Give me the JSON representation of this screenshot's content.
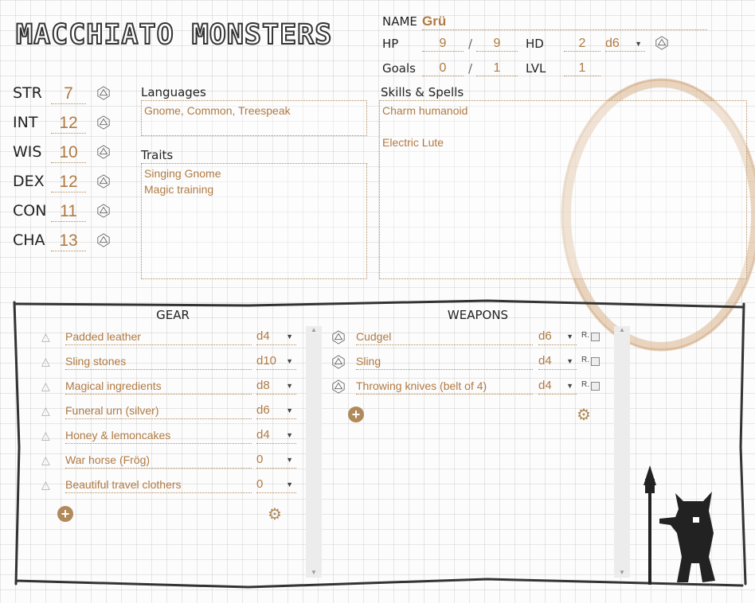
{
  "app": {
    "title": "MACCHIATO MONSTERS"
  },
  "header": {
    "name_label": "NAME",
    "name": "Grü",
    "hp_label": "HP",
    "hp": "9",
    "hp_sep": "/",
    "hp_max": "9",
    "hd_label": "HD",
    "hd": "2",
    "hd_die": "d6",
    "goals_label": "Goals",
    "goals": "0",
    "goals_sep": "/",
    "goals_max": "1",
    "lvl_label": "LVL",
    "lvl": "1"
  },
  "stats": [
    {
      "name": "STR",
      "value": "7"
    },
    {
      "name": "INT",
      "value": "12"
    },
    {
      "name": "WIS",
      "value": "10"
    },
    {
      "name": "DEX",
      "value": "12"
    },
    {
      "name": "CON",
      "value": "11"
    },
    {
      "name": "CHA",
      "value": "13"
    }
  ],
  "languages": {
    "label": "Languages",
    "text": "Gnome, Common, Treespeak"
  },
  "traits": {
    "label": "Traits",
    "lines": [
      "Singing Gnome",
      "Magic training"
    ]
  },
  "skills": {
    "label": "Skills & Spells",
    "lines": [
      "Charm humanoid",
      "",
      "Electric Lute"
    ]
  },
  "gear": {
    "title": "GEAR",
    "items": [
      {
        "name": "Padded leather",
        "die": "d4"
      },
      {
        "name": "Sling stones",
        "die": "d10"
      },
      {
        "name": "Magical ingredients",
        "die": "d8"
      },
      {
        "name": "Funeral urn (silver)",
        "die": "d6"
      },
      {
        "name": "Honey & lemoncakes",
        "die": "d4"
      },
      {
        "name": "War horse (Frög)",
        "die": "0"
      },
      {
        "name": "Beautiful travel clothers",
        "die": "0"
      }
    ]
  },
  "weapons": {
    "title": "WEAPONS",
    "ranged_label": "R.",
    "items": [
      {
        "name": "Cudgel",
        "die": "d6"
      },
      {
        "name": "Sling",
        "die": "d4"
      },
      {
        "name": "Throwing knives (belt of 4)",
        "die": "d4"
      }
    ]
  },
  "icons": {
    "die": "d20-icon",
    "add": "plus-circle-icon",
    "settings": "gear-icon",
    "dropdown": "caret-down-icon"
  },
  "colors": {
    "accent": "#b07a42",
    "ink": "#222222",
    "button": "#b08a5a"
  }
}
